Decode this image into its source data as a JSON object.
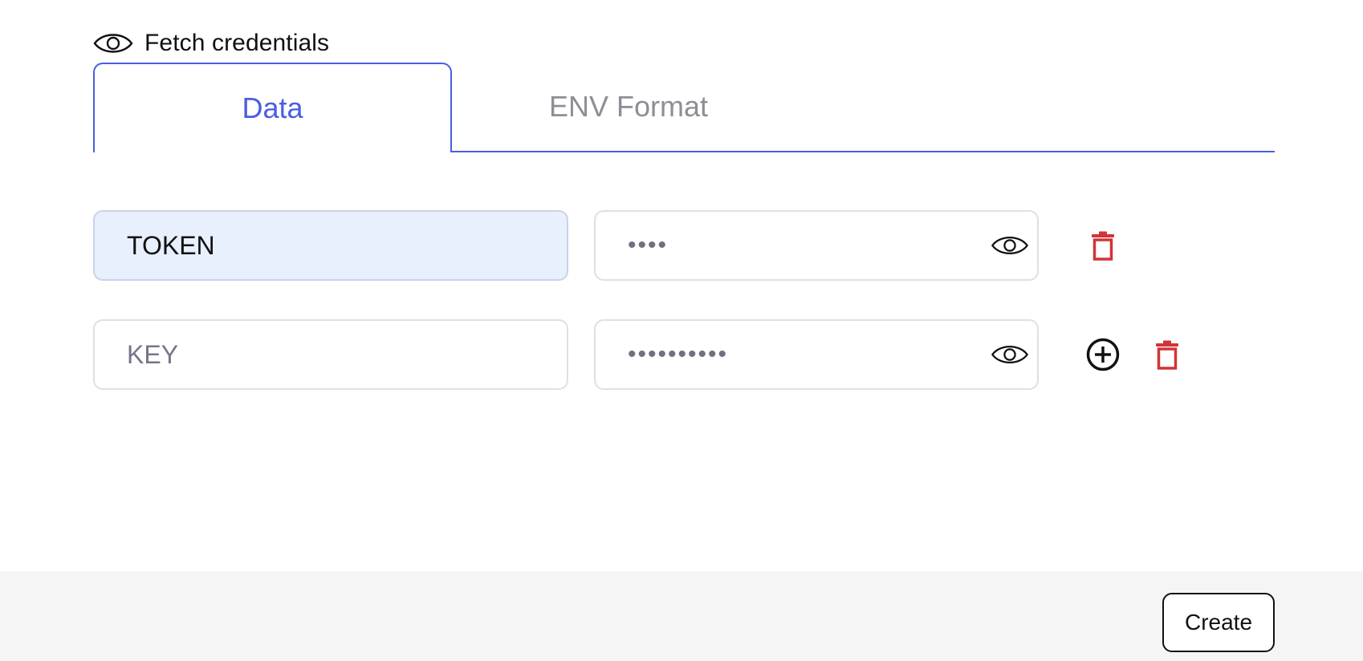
{
  "header": {
    "title": "Fetch credentials",
    "icon": "eye-icon"
  },
  "tabs": [
    {
      "label": "Data",
      "active": true
    },
    {
      "label": "ENV Format",
      "active": false
    }
  ],
  "rows": [
    {
      "key_value": "TOKEN",
      "key_placeholder": "",
      "secret_mask": "••••",
      "actions": [
        "delete"
      ]
    },
    {
      "key_value": "",
      "key_placeholder": "KEY",
      "secret_mask": "••••••••••",
      "actions": [
        "add",
        "delete"
      ]
    }
  ],
  "footer": {
    "create_label": "Create"
  },
  "colors": {
    "accent": "#4a5ee0",
    "delete": "#d13438",
    "filled_input_bg": "#e8f0fe",
    "footer_bg": "#f5f5f5"
  }
}
